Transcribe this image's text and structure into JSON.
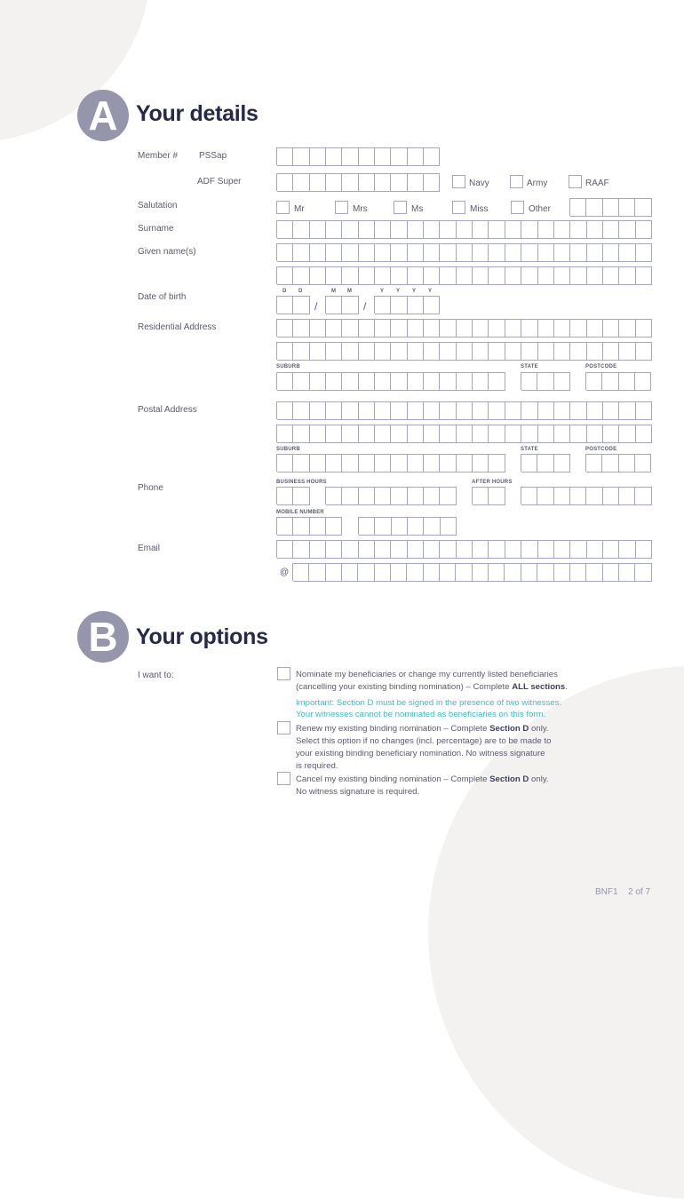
{
  "section_a": {
    "letter": "A",
    "title": "Your details",
    "member_label": "Member #",
    "pssap_label": "PSSap",
    "adf_label": "ADF Super",
    "service_options": [
      "Navy",
      "Army",
      "RAAF"
    ],
    "salutation_label": "Salutation",
    "salutation_options": [
      "Mr",
      "Mrs",
      "Ms",
      "Miss",
      "Other"
    ],
    "surname_label": "Surname",
    "given_names_label": "Given name(s)",
    "dob_label": "Date of birth",
    "dob_hints": {
      "d": "D",
      "m": "M",
      "y": "Y"
    },
    "dob_separator": "/",
    "residential_label": "Residential Address",
    "postal_label": "Postal Address",
    "suburb_label": "SUBURB",
    "state_label": "STATE",
    "postcode_label": "POSTCODE",
    "phone_label": "Phone",
    "business_hours_label": "BUSINESS HOURS",
    "after_hours_label": "AFTER HOURS",
    "mobile_label": "MOBILE NUMBER",
    "email_label": "Email",
    "at_symbol": "@"
  },
  "section_b": {
    "letter": "B",
    "title": "Your options",
    "i_want_to_label": "I want to:",
    "options": [
      {
        "line1": "Nominate my beneficiaries or change my currently listed beneficiaries",
        "line2_pre": "(cancelling your existing binding nomination) – Complete ",
        "line2_bold": "ALL sections",
        "line2_post": ".",
        "important_1": "Important: Section D must be signed in the presence of two witnesses.",
        "important_2": "Your witnesses cannot be nominated as beneficiaries on this form."
      },
      {
        "line1_pre": "Renew my existing binding nomination – Complete ",
        "line1_bold": "Section D",
        "line1_post": " only.",
        "line2": "Select this option if no changes (incl. percentage) are to be made to",
        "line3": "your existing binding beneficiary nomination. No witness signature",
        "line4": "is required."
      },
      {
        "line1_pre": "Cancel my existing binding nomination – Complete ",
        "line1_bold": "Section D",
        "line1_post": " only.",
        "line2": "No witness signature is required."
      }
    ]
  },
  "footer": {
    "form_code": "BNF1",
    "page": "2 of 7"
  },
  "colors": {
    "badge": "#9595ab",
    "title": "#262a4a",
    "box_border": "#a6a6c4",
    "important": "#3cbac8",
    "background_shape": "#f3f2f1"
  }
}
